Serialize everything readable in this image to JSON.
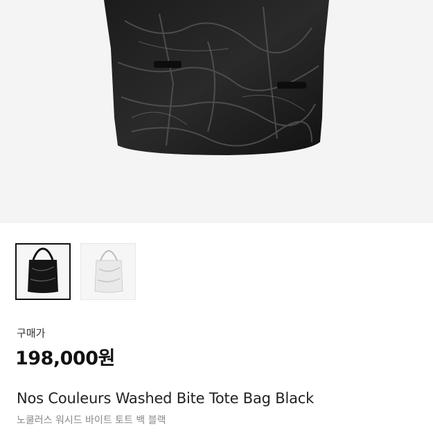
{
  "product": {
    "price_label": "구매가",
    "price": "198,000원",
    "name_en": "Nos Couleurs Washed Bite Tote Bag Black",
    "name_ko": "노쿨러스 워시드 바이트 토트 백 블랙"
  },
  "gallery": {
    "thumbnails": [
      {
        "variant": "black",
        "selected": true
      },
      {
        "variant": "white",
        "selected": false
      }
    ]
  },
  "colors": {
    "bag_black": "#151515",
    "bag_white": "#e9e9e9",
    "selected_border": "#111111"
  }
}
